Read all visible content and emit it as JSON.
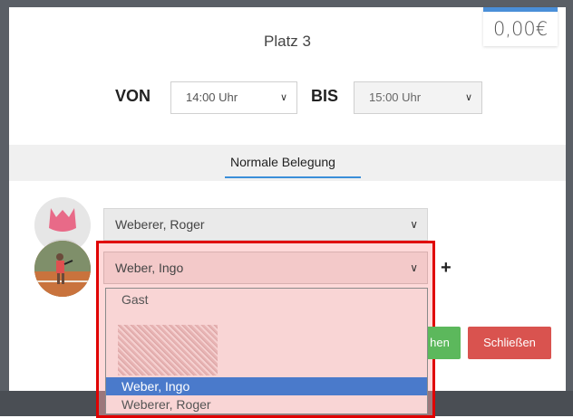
{
  "price": {
    "value": "0,00€"
  },
  "court": {
    "title": "Platz 3"
  },
  "time": {
    "from_label": "VON",
    "from_value": "14:00 Uhr",
    "to_label": "BIS",
    "to_value": "15:00 Uhr"
  },
  "tabs": {
    "active": "Normale Belegung"
  },
  "players": {
    "slot1": "Weberer, Roger",
    "slot2": "Weber, Ingo",
    "add_symbol": "+"
  },
  "dropdown": {
    "options": [
      "Gast",
      "",
      "Weber, Ingo",
      "Weberer, Roger"
    ],
    "selected": "Weber, Ingo"
  },
  "buttons": {
    "save_partial": "hen",
    "close": "Schließen"
  },
  "colors": {
    "accent_blue": "#3a8fd9",
    "save_green": "#5cb85c",
    "close_red": "#d9534f",
    "highlight_red": "#e00000",
    "selected_option": "#4a7acb"
  },
  "icons": {
    "chevron": "chevron-down-icon",
    "plus": "plus-icon"
  }
}
